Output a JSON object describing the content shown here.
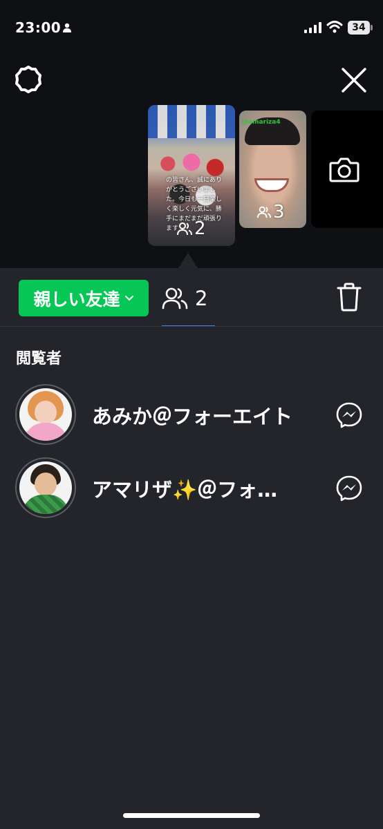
{
  "status_bar": {
    "time": "23:00",
    "battery": "34"
  },
  "stories": [
    {
      "viewer_count": "2",
      "caption": "の皆さん、誠にありがとうございました。今日も一日楽しく楽しく元気に、勝手にまだまだ頑張ります"
    },
    {
      "viewer_count": "3",
      "tag": "@amariza4"
    }
  ],
  "audience": {
    "label": "親しい友達"
  },
  "viewers_tab": {
    "count": "2"
  },
  "section": {
    "label": "閲覧者"
  },
  "viewers": [
    {
      "name": "あみか＠フォーエイト"
    },
    {
      "name": "アマリザ✨＠フォ…"
    }
  ],
  "colors": {
    "accent_green": "#06c755",
    "panel": "#23252b",
    "top_bg": "#0e1013",
    "tab_underline": "#3c86d6"
  },
  "icons": [
    "person-icon",
    "signal-icon",
    "wifi-icon",
    "gear-icon",
    "close-icon",
    "users-icon",
    "camera-icon",
    "chevron-down-icon",
    "trash-icon",
    "messenger-icon"
  ]
}
